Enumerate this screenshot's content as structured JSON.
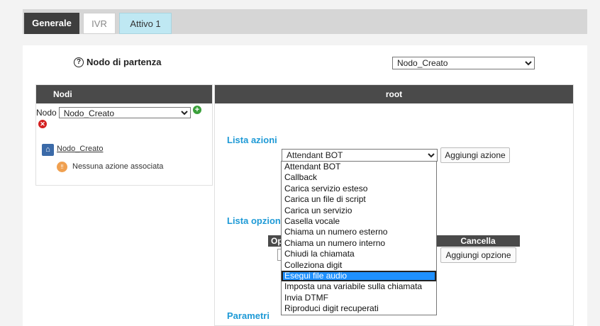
{
  "tabs": [
    {
      "label": "Generale",
      "active": true
    },
    {
      "label": "IVR",
      "active": false
    },
    {
      "label": "Attivo 1",
      "active": false
    }
  ],
  "start_node": {
    "label": "Nodo di partenza",
    "selected": "Nodo_Creato"
  },
  "left_panel": {
    "header": "Nodi",
    "nodo_label": "Nodo",
    "nodo_selected": "Nodo_Creato",
    "node_link": "Nodo_Creato",
    "no_action_text": "Nessuna azione associata"
  },
  "right_panel": {
    "header": "root",
    "lista_azioni_title": "Lista azioni",
    "action_selected": "Attendant BOT",
    "add_action_label": "Aggiungi azione",
    "lista_opzioni_title": "Lista opzion",
    "opt_col_left": "Op",
    "opt_col_cancel": "Cancella",
    "add_option_label": "Aggiungi opzione",
    "parametri_title": "Parametri"
  },
  "dropdown": {
    "items": [
      "Attendant BOT",
      "Callback",
      "Carica servizio esteso",
      "Carica un file di script",
      "Carica un servizio",
      "Casella vocale",
      "Chiama un numero esterno",
      "Chiama un numero interno",
      "Chiudi la chiamata",
      "Colleziona digit",
      "Esegui file audio",
      "Imposta una variabile sulla chiamata",
      "Invia DTMF",
      "Riproduci digit recuperati"
    ],
    "highlighted": "Esegui file audio"
  },
  "colors": {
    "accent_title": "#1e9ad6",
    "header_dark": "#4a4a4a",
    "tab_active": "#3e3e3e",
    "tab_attivo": "#bfe8f3",
    "selection": "#1e90ff"
  }
}
